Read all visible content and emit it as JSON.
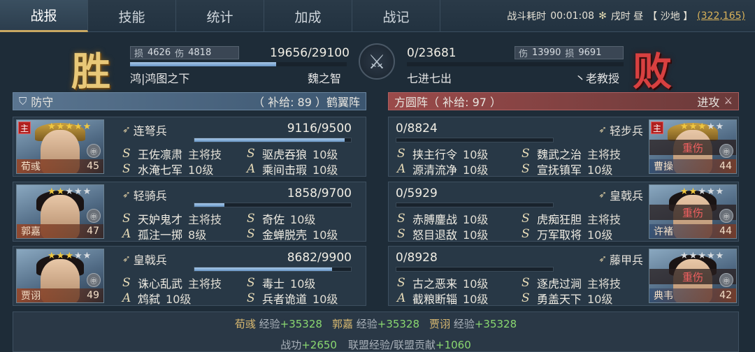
{
  "tabs": [
    "战报",
    "技能",
    "统计",
    "加成",
    "战记"
  ],
  "battle_info": {
    "time_label": "战斗耗时",
    "time": "00:01:08",
    "period": "戌时 昼",
    "terrain": "【 沙地 】",
    "coords": "(322,165)"
  },
  "left": {
    "result_char": "胜",
    "loss_label": "损",
    "loss": "4626",
    "damage_label": "伤",
    "damage": "4818",
    "troops": "19656/29100",
    "troop_fraction": 0.675,
    "player": "鸿|鸿图之下",
    "commander": "魏之智",
    "stance": "防守",
    "formation": "（ 补给: 89 ）鹤翼阵"
  },
  "right": {
    "result_char": "败",
    "troops": "0/23681",
    "troop_fraction": 0.0,
    "damage_label": "伤",
    "damage": "13990",
    "loss_label": "损",
    "loss": "9691",
    "player": "七进七出",
    "commander": "丶老教授",
    "formation": "方圆阵（ 补给: 97 ）",
    "stance": "进攻"
  },
  "left_generals": [
    {
      "name": "荀彧",
      "level": "45",
      "main": "主",
      "stars": 5,
      "stars_on": 5,
      "unit": "连弩兵",
      "troops": "9116/9500",
      "troop_fraction": 0.96,
      "skills": [
        {
          "grade": "S",
          "name": "王佐凛肃",
          "lv": "主将技"
        },
        {
          "grade": "S",
          "name": "驱虎吞狼",
          "lv": "10级"
        },
        {
          "grade": "S",
          "name": "水淹七军",
          "lv": "10级"
        },
        {
          "grade": "A",
          "name": "乘间击瑕",
          "lv": "10级"
        }
      ]
    },
    {
      "name": "郭嘉",
      "level": "47",
      "main": "",
      "stars": 5,
      "stars_on": 2,
      "unit": "轻骑兵",
      "troops": "1858/9700",
      "troop_fraction": 0.19,
      "skills": [
        {
          "grade": "S",
          "name": "天妒鬼才",
          "lv": "主将技"
        },
        {
          "grade": "S",
          "name": "奇佐",
          "lv": "10级"
        },
        {
          "grade": "A",
          "name": "孤注一掷",
          "lv": "8级"
        },
        {
          "grade": "S",
          "name": "金蝉脱壳",
          "lv": "10级"
        }
      ]
    },
    {
      "name": "贾诩",
      "level": "49",
      "main": "",
      "stars": 5,
      "stars_on": 3,
      "unit": "皇戟兵",
      "troops": "8682/9900",
      "troop_fraction": 0.88,
      "skills": [
        {
          "grade": "S",
          "name": "诛心乱武",
          "lv": "主将技"
        },
        {
          "grade": "S",
          "name": "毒士",
          "lv": "10级"
        },
        {
          "grade": "A",
          "name": "鸩弑",
          "lv": "10级"
        },
        {
          "grade": "S",
          "name": "兵者诡道",
          "lv": "10级"
        }
      ]
    }
  ],
  "right_generals": [
    {
      "name": "曹操",
      "level": "44",
      "main": "主",
      "stars": 5,
      "stars_on": 3,
      "status": "重伤",
      "unit": "轻步兵",
      "troops": "0/8824",
      "troop_fraction": 0.0,
      "skills": [
        {
          "grade": "S",
          "name": "挟主行令",
          "lv": "10级"
        },
        {
          "grade": "S",
          "name": "魏武之治",
          "lv": "主将技"
        },
        {
          "grade": "A",
          "name": "源清流净",
          "lv": "10级"
        },
        {
          "grade": "S",
          "name": "宣抚镇军",
          "lv": "10级"
        }
      ]
    },
    {
      "name": "许褚",
      "level": "44",
      "main": "",
      "stars": 5,
      "stars_on": 2,
      "status": "重伤",
      "unit": "皇戟兵",
      "troops": "0/5929",
      "troop_fraction": 0.0,
      "skills": [
        {
          "grade": "S",
          "name": "赤膊鏖战",
          "lv": "10级"
        },
        {
          "grade": "S",
          "name": "虎痴狂胆",
          "lv": "主将技"
        },
        {
          "grade": "S",
          "name": "怒目退敌",
          "lv": "10级"
        },
        {
          "grade": "S",
          "name": "万军取将",
          "lv": "10级"
        }
      ]
    },
    {
      "name": "典韦",
      "level": "42",
      "main": "",
      "stars": 5,
      "stars_on": 0,
      "status": "重伤",
      "unit": "藤甲兵",
      "troops": "0/8928",
      "troop_fraction": 0.0,
      "skills": [
        {
          "grade": "S",
          "name": "古之恶来",
          "lv": "10级"
        },
        {
          "grade": "S",
          "name": "逐虎过涧",
          "lv": "主将技"
        },
        {
          "grade": "A",
          "name": "截粮断辎",
          "lv": "10级"
        },
        {
          "grade": "S",
          "name": "勇盖天下",
          "lv": "10级"
        }
      ]
    }
  ],
  "summary": {
    "exp_label": "经验",
    "exp": [
      {
        "name": "荀彧",
        "value": "+35328"
      },
      {
        "name": "郭嘉",
        "value": "+35328"
      },
      {
        "name": "贾诩",
        "value": "+35328"
      }
    ],
    "merit_label": "战功",
    "merit": "+2650",
    "alliance_label": "联盟经验/联盟贡献",
    "alliance": "+1060"
  },
  "colors": {
    "win_gold": "#e8c878",
    "lose_red": "#d84040",
    "defense_blue": "#5a7590",
    "attack_red": "#9a4a4a",
    "exp_green": "#8ad870"
  }
}
